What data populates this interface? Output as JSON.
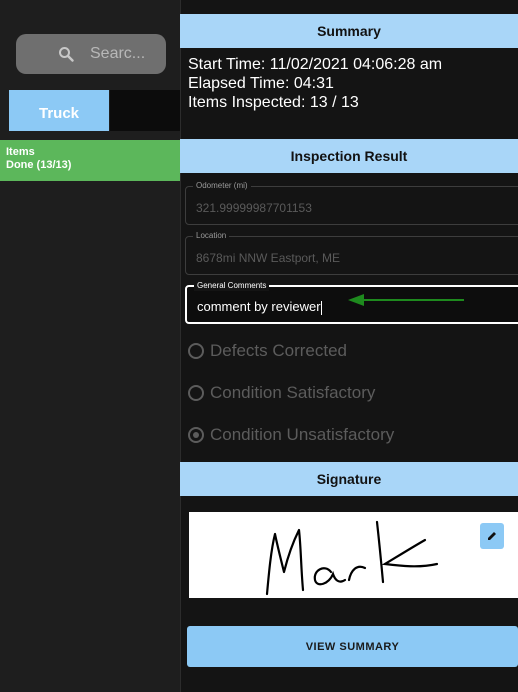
{
  "sidebar": {
    "search": {
      "label": "Searc...",
      "icon": "search-icon"
    },
    "tabs": [
      {
        "label": "Truck"
      }
    ],
    "items_row": {
      "title": "Items",
      "status": "Done (13/13)"
    }
  },
  "summary": {
    "header": "Summary",
    "start_time": "Start Time: 11/02/2021 04:06:28 am",
    "elapsed_time": "Elapsed Time: 04:31",
    "items_inspected": "Items Inspected: 13 / 13"
  },
  "inspection": {
    "header": "Inspection Result",
    "odometer": {
      "label": "Odometer (mi)",
      "value": "321.99999987701153"
    },
    "location": {
      "label": "Location",
      "value": "8678mi NNW Eastport, ME"
    },
    "comments": {
      "label": "General Comments",
      "value": "comment by reviewer"
    },
    "options": [
      {
        "label": "Defects Corrected",
        "selected": false
      },
      {
        "label": "Condition Satisfactory",
        "selected": false
      },
      {
        "label": "Condition Unsatisfactory",
        "selected": true
      }
    ]
  },
  "signature": {
    "header": "Signature",
    "signer_text": "Mark",
    "edit_icon": "pencil-icon"
  },
  "actions": {
    "view_summary": "VIEW SUMMARY"
  },
  "colors": {
    "accent_blue": "#8cc9f5",
    "header_blue": "#a9d6f8",
    "green": "#5cb75b",
    "annotation_arrow": "#1e8a1e"
  }
}
